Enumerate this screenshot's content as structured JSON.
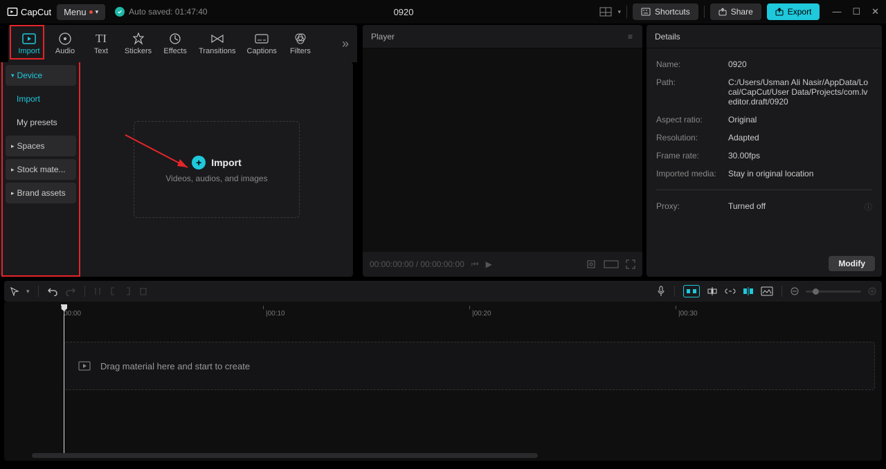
{
  "app": {
    "name": "CapCut",
    "menu": "Menu",
    "autosave": "Auto saved: 01:47:40",
    "title": "0920"
  },
  "topbar": {
    "shortcuts": "Shortcuts",
    "share": "Share",
    "export": "Export"
  },
  "tooltabs": {
    "import": "Import",
    "audio": "Audio",
    "text": "Text",
    "stickers": "Stickers",
    "effects": "Effects",
    "transitions": "Transitions",
    "captions": "Captions",
    "filters": "Filters"
  },
  "sidebar": {
    "device": "Device",
    "import": "Import",
    "presets": "My presets",
    "spaces": "Spaces",
    "stock": "Stock mate...",
    "brand": "Brand assets"
  },
  "importBox": {
    "title": "Import",
    "sub": "Videos, audios, and images"
  },
  "player": {
    "title": "Player",
    "time": "00:00:00:00 / 00:00:00:00"
  },
  "details": {
    "title": "Details",
    "rows": {
      "name_l": "Name:",
      "name_v": "0920",
      "path_l": "Path:",
      "path_v": "C:/Users/Usman Ali Nasir/AppData/Local/CapCut/User Data/Projects/com.lveditor.draft/0920",
      "aspect_l": "Aspect ratio:",
      "aspect_v": "Original",
      "res_l": "Resolution:",
      "res_v": "Adapted",
      "fps_l": "Frame rate:",
      "fps_v": "30.00fps",
      "imp_l": "Imported media:",
      "imp_v": "Stay in original location",
      "proxy_l": "Proxy:",
      "proxy_v": "Turned off"
    },
    "modify": "Modify"
  },
  "timeline": {
    "ticks": [
      "00:00",
      "|00:10",
      "|00:20",
      "|00:30"
    ],
    "drop": "Drag material here and start to create"
  }
}
